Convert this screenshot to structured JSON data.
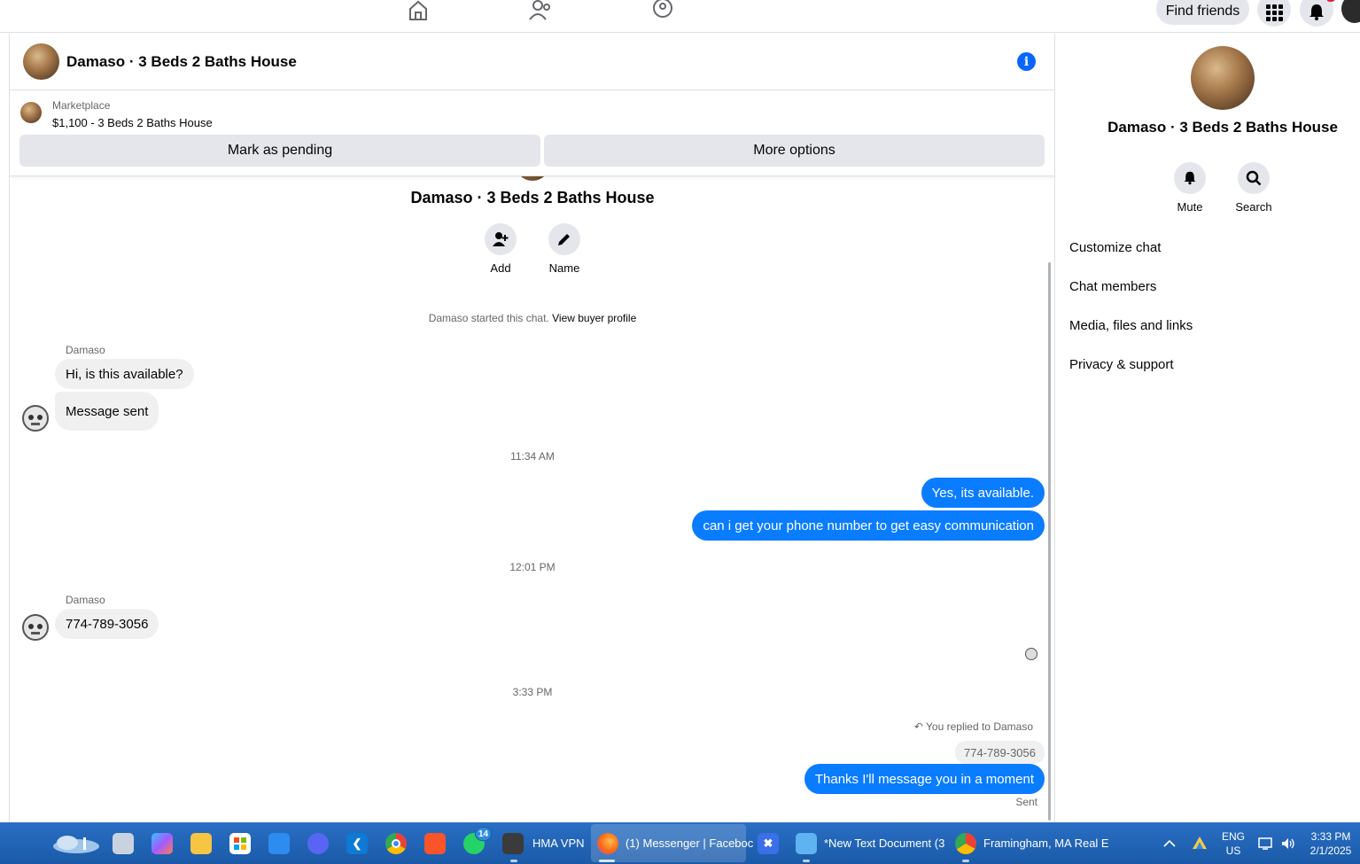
{
  "topnav": {
    "find_friends": "Find friends"
  },
  "chat": {
    "title": "Damaso · 3 Beds 2 Baths House",
    "marketplace_label": "Marketplace",
    "listing": "$1,100 - 3 Beds 2 Baths House",
    "mark_pending": "Mark as pending",
    "more_options": "More options",
    "intro_title": "Damaso · 3 Beds 2 Baths House",
    "actions": [
      {
        "label": "Add",
        "icon": "add-person-icon"
      },
      {
        "label": "Name",
        "icon": "pencil-icon"
      }
    ],
    "started_text": "Damaso started this chat.",
    "view_buyer": "View buyer profile",
    "messages": {
      "sender1": "Damaso",
      "in1": "Hi, is this available?",
      "in2": "Message sent",
      "time1": "11:34 AM",
      "out1": "Yes, its available.",
      "out2": "can i get your phone number to get easy communication",
      "time2": "12:01 PM",
      "sender2": "Damaso",
      "in3": "774-789-3056",
      "time3": "3:33 PM",
      "replied": "You replied to Damaso",
      "quoted": "774-789-3056",
      "out3": "Thanks I'll message you in a moment",
      "status": "Sent"
    },
    "colors": {
      "outgoing": "#0a7cff",
      "accent": "#0866ff"
    }
  },
  "panel": {
    "title": "Damaso · 3 Beds 2 Baths House",
    "actions": [
      {
        "label": "Mute",
        "icon": "bell-icon"
      },
      {
        "label": "Search",
        "icon": "search-icon"
      }
    ],
    "menu": [
      "Customize chat",
      "Chat members",
      "Media, files and links",
      "Privacy & support"
    ]
  },
  "taskbar": {
    "hma": "HMA VPN",
    "messenger": "(1) Messenger | Faceboc",
    "notepad": "*New Text Document (3",
    "chrome_window": "Framingham, MA Real E",
    "whatsapp_badge": "14",
    "lang": "ENG",
    "region": "US",
    "time": "3:33 PM",
    "date": "2/1/2025"
  }
}
